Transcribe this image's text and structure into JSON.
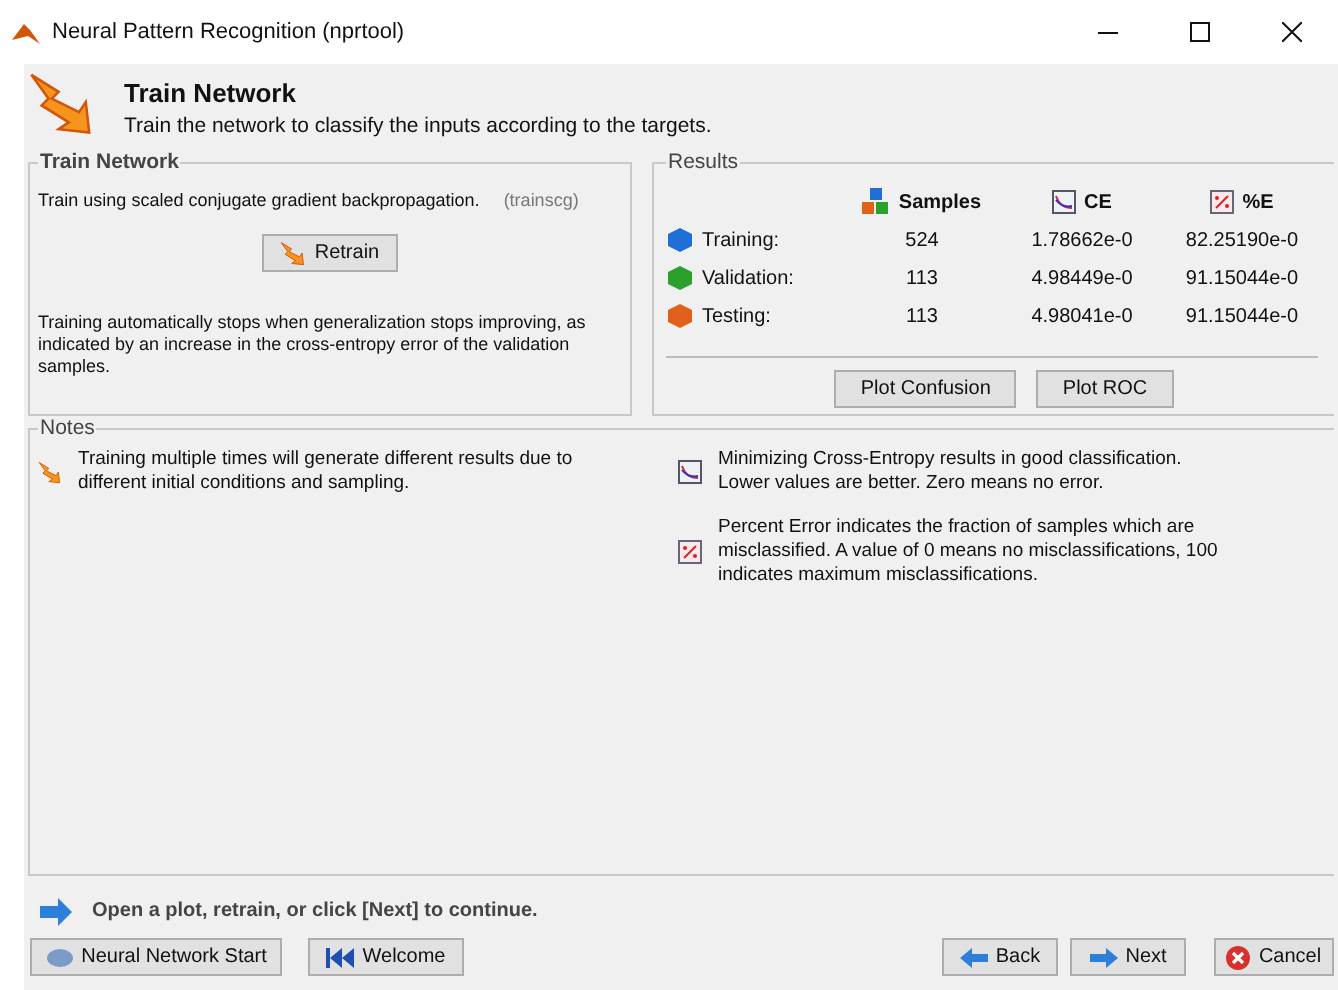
{
  "window": {
    "title": "Neural Pattern Recognition (nprtool)"
  },
  "header": {
    "title": "Train Network",
    "subtitle": "Train the network to classify the inputs according to the targets."
  },
  "train_group": {
    "legend": "Train Network",
    "method": "Train using scaled conjugate gradient backpropagation.",
    "method_code": "(trainscg)",
    "button": "Retrain",
    "note": "Training automatically stops when generalization stops improving, as indicated by an increase in the cross-entropy error of the validation samples."
  },
  "results": {
    "legend": "Results",
    "columns": [
      "Samples",
      "CE",
      "%E"
    ],
    "rows": [
      {
        "label": "Training:",
        "color": "#1f6fd6",
        "samples": "524",
        "ce": "1.78662e-0",
        "pe": "82.25190e-0"
      },
      {
        "label": "Validation:",
        "color": "#2aa12a",
        "samples": "113",
        "ce": "4.98449e-0",
        "pe": "91.15044e-0"
      },
      {
        "label": "Testing:",
        "color": "#e0621a",
        "samples": "113",
        "ce": "4.98041e-0",
        "pe": "91.15044e-0"
      }
    ],
    "buttons": [
      "Plot Confusion",
      "Plot ROC"
    ]
  },
  "notes": {
    "legend": "Notes",
    "left": "Training multiple times will generate different results due to different initial conditions and sampling.",
    "right": [
      {
        "kind": "ce",
        "text": "Minimizing Cross-Entropy results in good classification. Lower values are better. Zero means no error."
      },
      {
        "kind": "pe",
        "text": "Percent Error  indicates the fraction of samples which are misclassified. A value of 0 means no misclassifications, 100 indicates maximum misclassifications."
      }
    ]
  },
  "hint": "Open a plot, retrain, or click [Next] to continue.",
  "footer": {
    "left_buttons": [
      "Neural Network Start",
      "Welcome"
    ],
    "right_buttons": [
      "Back",
      "Next",
      "Cancel"
    ]
  }
}
